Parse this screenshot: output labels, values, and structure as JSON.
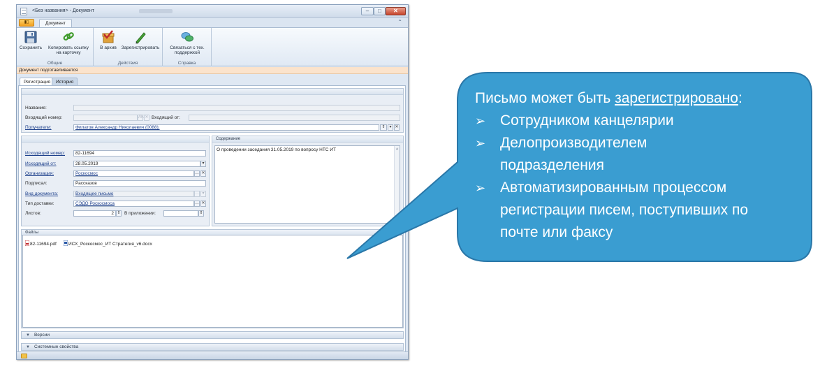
{
  "window": {
    "title": "<Без названия> - Документ",
    "controls": {
      "minimize": "–",
      "maximize": "□",
      "close": "✕"
    }
  },
  "ribbon": {
    "office_button": "▮▯",
    "tab": "Документ",
    "groups": [
      {
        "label": "Общие",
        "buttons": [
          {
            "label": "Сохранить",
            "icon": "save-disk-icon"
          },
          {
            "label": "Копировать ссылку на карточку",
            "icon": "copy-link-icon"
          }
        ]
      },
      {
        "label": "Действия",
        "buttons": [
          {
            "label": "В архив",
            "icon": "archive-check-icon"
          },
          {
            "label": "Зарегистрировать",
            "icon": "register-pen-icon"
          }
        ]
      },
      {
        "label": "Справка",
        "buttons": [
          {
            "label": "Связаться с тех. поддержкой",
            "icon": "support-chat-icon"
          }
        ]
      }
    ]
  },
  "doc_status": "Документ подготавливается",
  "tabs": {
    "registration": "Регистрация",
    "history": "История"
  },
  "header_panel": {
    "name_label": "Название:",
    "name_value": "",
    "incoming_number_label": "Входящий номер:",
    "incoming_number_value": "",
    "incoming_number_btn": "ЛЮ",
    "incoming_from_label": "Входящий от:",
    "incoming_from_value": "",
    "recipients_label": "Получатели:",
    "recipients_value": "Филатов Александр Николаевич (0088);"
  },
  "outgoing_panel": {
    "outgoing_number_label": "Исходящий номер:",
    "outgoing_number_value": "82-11694",
    "outgoing_from_label": "Исходящий от:",
    "outgoing_from_value": "28.05.2019",
    "organization_label": "Организация:",
    "organization_value": "Роскосмос",
    "signed_label": "Подписал:",
    "signed_value": "Рассказов",
    "doc_kind_label": "Вид документа:",
    "doc_kind_value": "Входящее письмо",
    "delivery_label": "Тип доставки:",
    "delivery_value": "СЭДО Роскосмоса",
    "sheets_label": "Листов:",
    "sheets_value": "2",
    "attachment_label": "В приложении:",
    "attachment_value": ""
  },
  "content_panel": {
    "title": "Содержание",
    "text": "О проведении заседания 31.05.2019 по вопросу НТС ИТ"
  },
  "files_panel": {
    "title": "Файлы",
    "files": [
      {
        "name": "82-11694.pdf",
        "icon": "pdf-file-icon"
      },
      {
        "name": "ИСХ_Роскосмос_ИТ Стратегия_v6.docx",
        "icon": "word-file-icon"
      }
    ]
  },
  "sections": {
    "versions": "Версии",
    "system": "Системные свойства"
  },
  "callout": {
    "lead": "Письмо может быть ",
    "lead_underlined": "зарегистрировано",
    "lead_end": ":",
    "bullets": [
      "Сотрудником канцелярии",
      "Делопроизводителем подразделения",
      "Автоматизированным процессом регистрации писем, поступивших по почте или факсу"
    ],
    "bullet_glyph": "➢",
    "fill": "#3a9dd1",
    "stroke": "#2a77a8"
  }
}
